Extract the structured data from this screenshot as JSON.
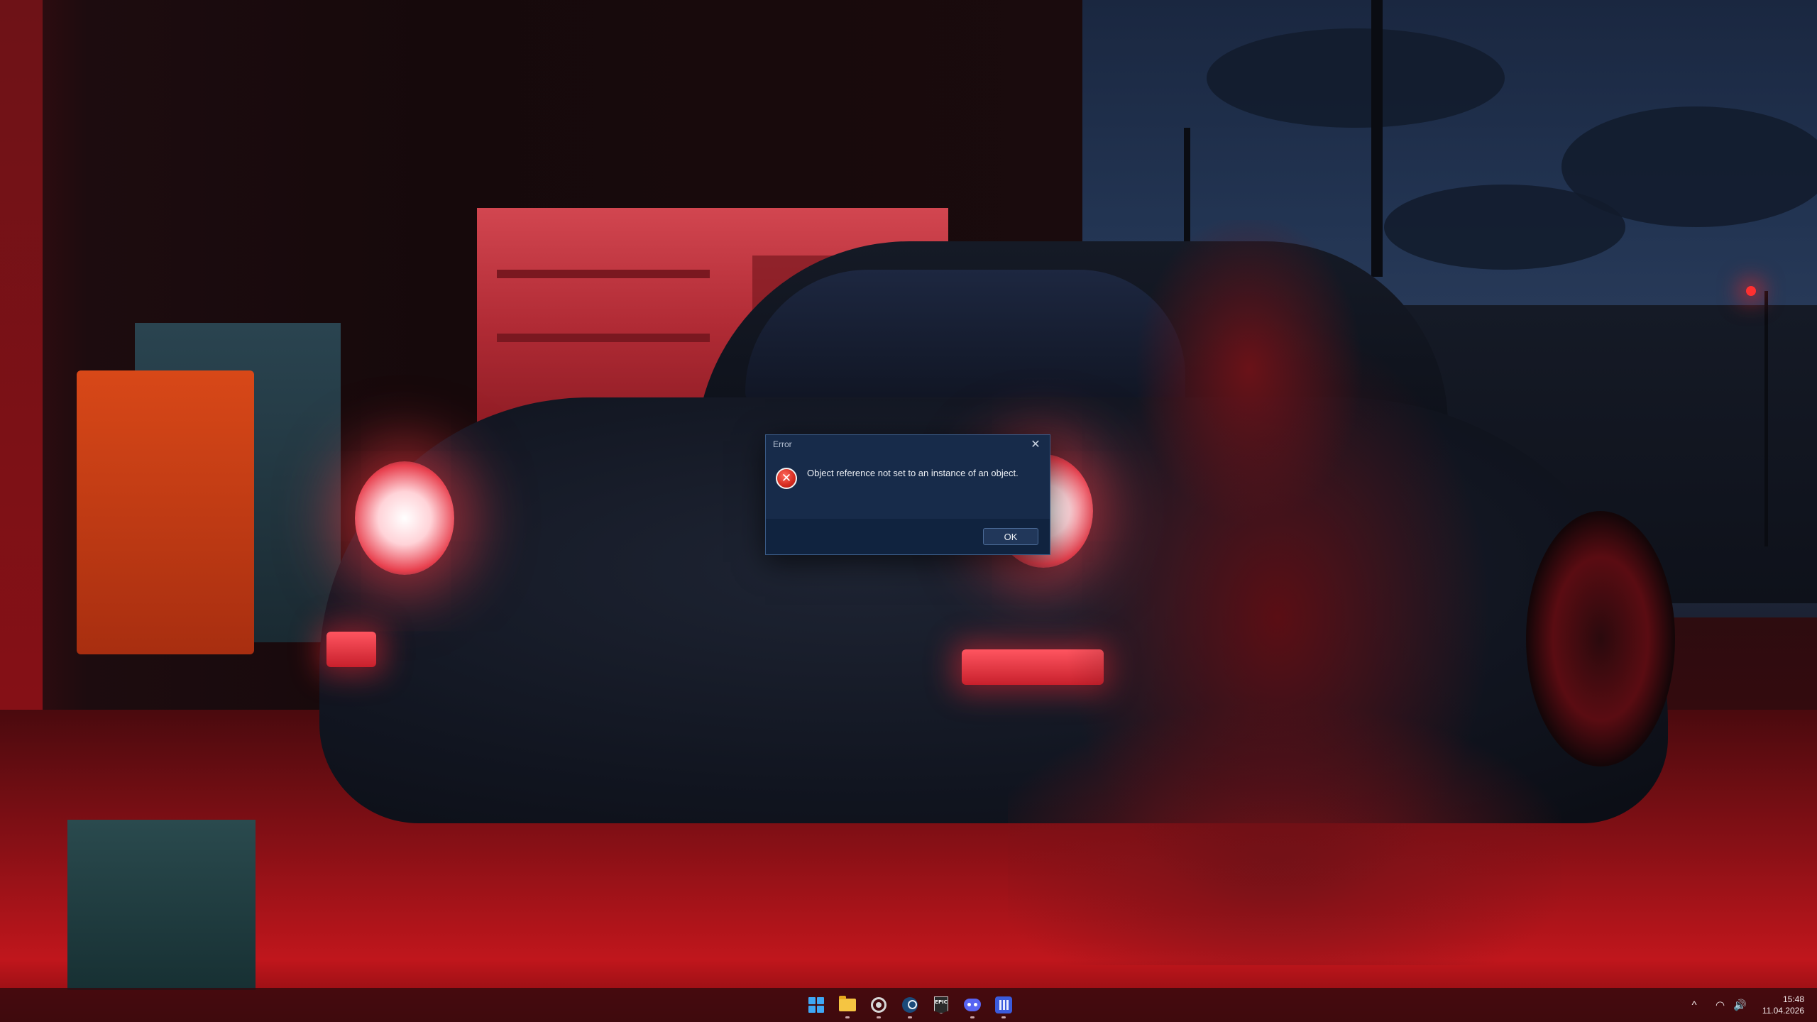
{
  "dialog": {
    "title": "Error",
    "close_glyph": "✕",
    "icon": "error-icon",
    "icon_glyph": "✕",
    "message": "Object reference not set to an instance of an object.",
    "ok_label": "OK"
  },
  "taskbar": {
    "apps": [
      {
        "name": "start",
        "icon": "windows-logo-icon"
      },
      {
        "name": "file-explorer",
        "icon": "folder-icon",
        "running": true
      },
      {
        "name": "app-circle",
        "icon": "circle-icon",
        "running": true
      },
      {
        "name": "steam",
        "icon": "steam-icon",
        "running": true
      },
      {
        "name": "epic-games",
        "icon": "epic-games-icon",
        "label": "EPIC"
      },
      {
        "name": "discord",
        "icon": "discord-icon",
        "running": true
      },
      {
        "name": "app-blue",
        "icon": "app-blue-icon",
        "running": true
      }
    ],
    "tray": {
      "chevron_glyph": "^",
      "wifi_glyph": "◠",
      "volume_glyph": "🔊",
      "time": "15:48",
      "date": "11.04.2026"
    }
  },
  "colors": {
    "dialog_bg": "#172b4a",
    "dialog_footer": "#10233f",
    "taskbar_bg": "#320a0e",
    "wallpaper_accent": "#c0161c"
  }
}
